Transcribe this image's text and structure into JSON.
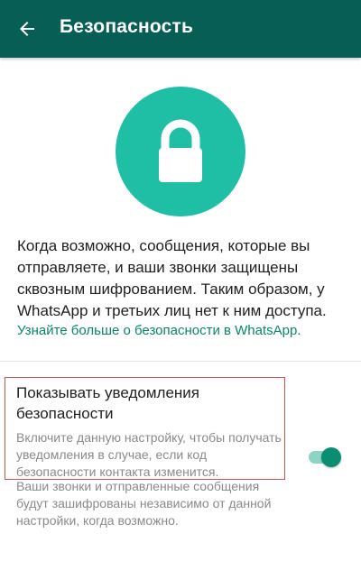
{
  "appbar": {
    "title": "Безопасность",
    "background": "#075e54",
    "back_icon": "arrow-back-icon"
  },
  "hero": {
    "icon": "lock-icon",
    "circle_color": "#1fbfa5"
  },
  "description": "Когда возможно, сообщения, которые вы отправляете, и ваши звонки защищены сквозным шифрованием. Таким образом, у WhatsApp и третьих лиц нет к ним доступа.",
  "learn_more_link": "Узнайте больше о безопасности в WhatsApp.",
  "setting": {
    "title": "Показывать уведомления безопасности",
    "description": "Включите данную настройку, чтобы получать уведомления в случае, если код безопасности контакта изменится.",
    "enabled": true
  },
  "footnote": "Ваши звонки и отправленные сообщения будут зашифрованы независимо от данной настройки, когда возможно.",
  "colors": {
    "accent": "#07876c",
    "toggle_thumb": "#0a8e72",
    "toggle_track": "#8fd3c4"
  }
}
